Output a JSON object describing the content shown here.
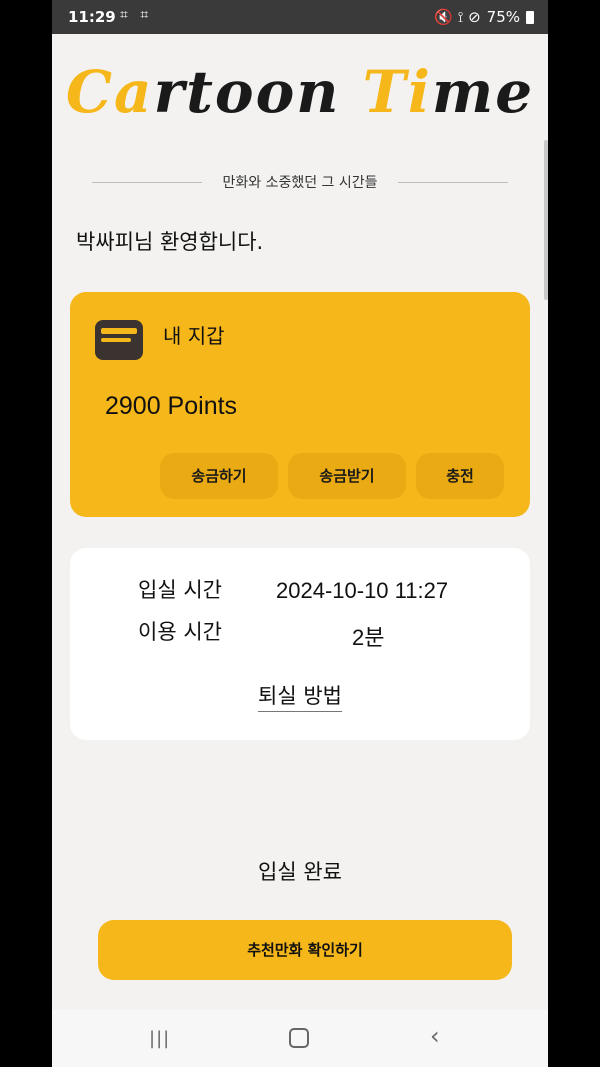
{
  "status_bar": {
    "time": "11:29",
    "left_icons": "⌗ ⌗",
    "right_icons": "🔇 ⟟ ⊘",
    "battery": "75%"
  },
  "app": {
    "logo_part1_accent": "Ca",
    "logo_part1_rest": "rtoon ",
    "logo_part2_accent": "Ti",
    "logo_part2_rest": "me",
    "tagline": "만화와 소중했던 그 시간들",
    "welcome": "박싸피님 환영합니다."
  },
  "wallet": {
    "title": "내 지갑",
    "points": "2900 Points",
    "buttons": {
      "send": "송금하기",
      "receive": "송금받기",
      "charge": "충전"
    }
  },
  "session": {
    "checkin_label": "입실 시간",
    "checkin_value": "2024-10-10 11:27",
    "usage_label": "이용 시간",
    "usage_value": "2분",
    "exit_link": "퇴실 방법"
  },
  "status": "입실 완료",
  "cta": "추천만화 확인하기",
  "colors": {
    "accent": "#f6b71a",
    "background": "#f3f2f0",
    "card": "#ffffff"
  }
}
